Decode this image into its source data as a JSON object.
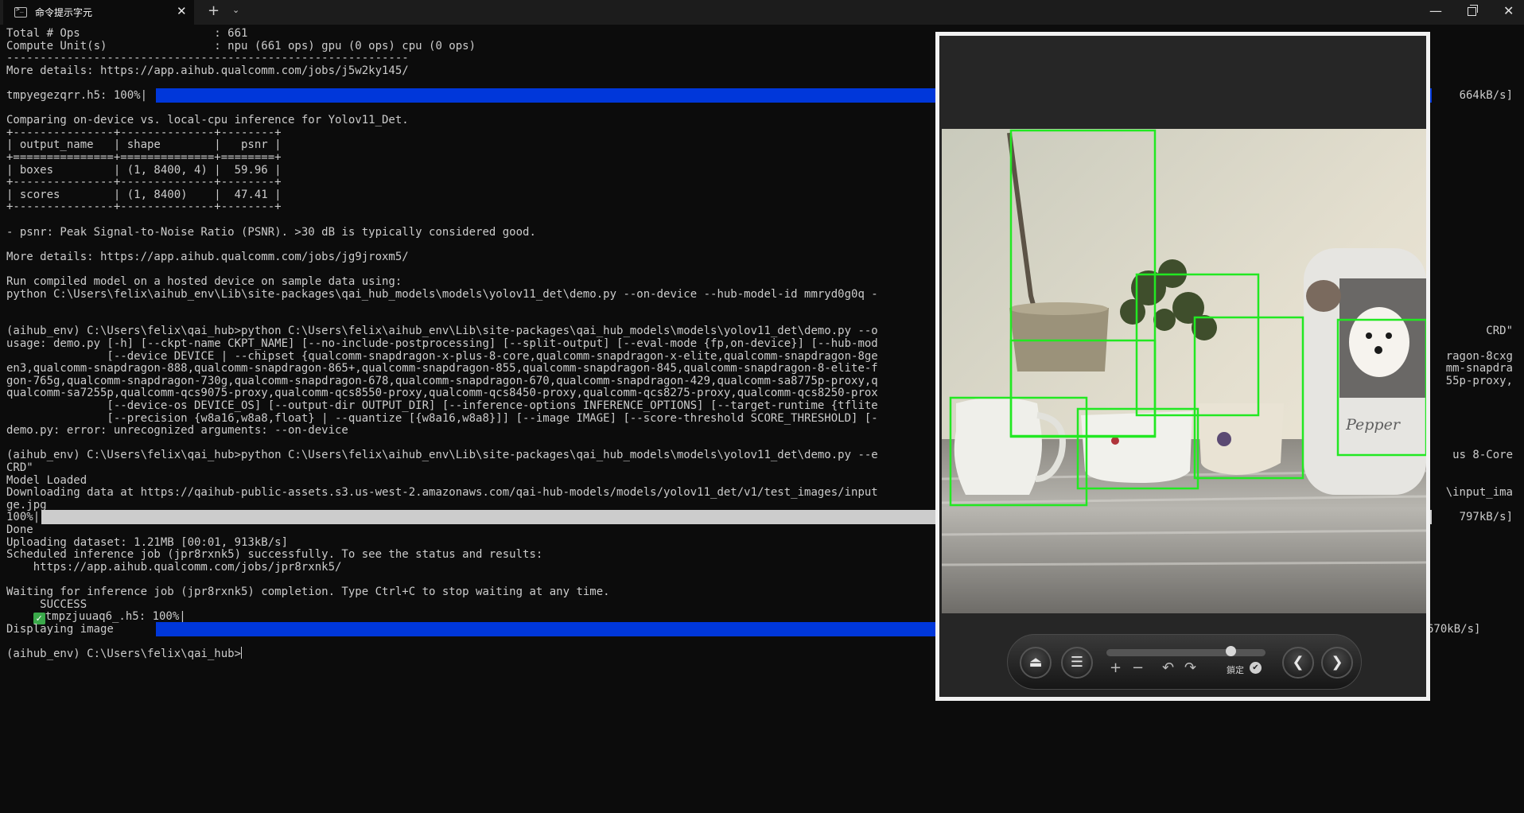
{
  "window": {
    "tab_title": "命令提示字元",
    "tab_close": "✕",
    "new_tab": "+",
    "tab_dropdown": "⌄",
    "minimize": "—",
    "close": "✕"
  },
  "terminal": {
    "lines": [
      "Total # Ops                    : 661",
      "Compute Unit(s)                : npu (661 ops) gpu (0 ops) cpu (0 ops)",
      "------------------------------------------------------------",
      "More details: https://app.aihub.qualcomm.com/jobs/j5w2ky145/",
      "",
      "tmpyegezqrr.h5: 100%|",
      "",
      "Comparing on-device vs. local-cpu inference for Yolov11_Det.",
      "+---------------+--------------+--------+",
      "| output_name   | shape        |   psnr |",
      "+===============+==============+========+",
      "| boxes         | (1, 8400, 4) |  59.96 |",
      "+---------------+--------------+--------+",
      "| scores        | (1, 8400)    |  47.41 |",
      "+---------------+--------------+--------+",
      "",
      "- psnr: Peak Signal-to-Noise Ratio (PSNR). >30 dB is typically considered good.",
      "",
      "More details: https://app.aihub.qualcomm.com/jobs/jg9jroxm5/",
      "",
      "Run compiled model on a hosted device on sample data using:",
      "python C:\\Users\\felix\\aihub_env\\Lib\\site-packages\\qai_hub_models\\models\\yolov11_det\\demo.py --on-device --hub-model-id mmryd0g0q -",
      "",
      "",
      "(aihub_env) C:\\Users\\felix\\qai_hub>python C:\\Users\\felix\\aihub_env\\Lib\\site-packages\\qai_hub_models\\models\\yolov11_det\\demo.py --o",
      "usage: demo.py [-h] [--ckpt-name CKPT_NAME] [--no-include-postprocessing] [--split-output] [--eval-mode {fp,on-device}] [--hub-mod",
      "               [--device DEVICE | --chipset {qualcomm-snapdragon-x-plus-8-core,qualcomm-snapdragon-x-elite,qualcomm-snapdragon-8ge",
      "en3,qualcomm-snapdragon-888,qualcomm-snapdragon-865+,qualcomm-snapdragon-855,qualcomm-snapdragon-845,qualcomm-snapdragon-8-elite-f",
      "gon-765g,qualcomm-snapdragon-730g,qualcomm-snapdragon-678,qualcomm-snapdragon-670,qualcomm-snapdragon-429,qualcomm-sa8775p-proxy,q",
      "qualcomm-sa7255p,qualcomm-qcs9075-proxy,qualcomm-qcs8550-proxy,qualcomm-qcs8450-proxy,qualcomm-qcs8275-proxy,qualcomm-qcs8250-prox",
      "               [--device-os DEVICE_OS] [--output-dir OUTPUT_DIR] [--inference-options INFERENCE_OPTIONS] [--target-runtime {tflite",
      "               [--precision {w8a16,w8a8,float} | --quantize [{w8a16,w8a8}]] [--image IMAGE] [--score-threshold SCORE_THRESHOLD] [-",
      "demo.py: error: unrecognized arguments: --on-device",
      "",
      "(aihub_env) C:\\Users\\felix\\qai_hub>python C:\\Users\\felix\\aihub_env\\Lib\\site-packages\\qai_hub_models\\models\\yolov11_det\\demo.py --e",
      "CRD\"",
      "Model Loaded",
      "Downloading data at https://qaihub-public-assets.s3.us-west-2.amazonaws.com/qai-hub-models/models/yolov11_det/v1/test_images/input",
      "ge.jpg",
      "100%|",
      "Done",
      "Uploading dataset: 1.21MB [00:01, 913kB/s]",
      "Scheduled inference job (jpr8rxnk5) successfully. To see the status and results:",
      "    https://app.aihub.qualcomm.com/jobs/jpr8rxnk5/",
      "",
      "Waiting for inference job (jpr8rxnk5) completion. Type Ctrl+C to stop waiting at any time.",
      "     SUCCESS",
      "tmpzjuuaq6_.h5: 100%|",
      "Displaying image",
      "",
      "(aihub_env) C:\\Users\\felix\\qai_hub>"
    ],
    "right_fragments": [
      {
        "row": 5,
        "text": "664kB/s]"
      },
      {
        "row": 24,
        "text": "CRD\""
      },
      {
        "row": 26,
        "text": "ragon-8cxg"
      },
      {
        "row": 27,
        "text": "mm-snapdra"
      },
      {
        "row": 28,
        "text": "55p-proxy,"
      },
      {
        "row": 34,
        "text": "us 8-Core"
      },
      {
        "row": 37,
        "text": "\\input_ima"
      },
      {
        "row": 39,
        "text": "797kB/s]"
      }
    ],
    "final_bar_suffix": "| 83.3k/83.3k [00:00<00:00, 670kB/s]",
    "progress_bars": [
      {
        "row": 5,
        "fraction": 1.0,
        "color": "#0037da"
      },
      {
        "row": 39,
        "fraction": 1.0,
        "color": "#cccccc"
      },
      {
        "row": 48,
        "fraction": 1.0,
        "color": "#0037da"
      }
    ],
    "success_icon": "check-icon"
  },
  "viewer": {
    "photo_caption": "Pepper",
    "toolbar": {
      "eject_icon": "⏏",
      "menu_icon": "☰",
      "zoom_in": "+",
      "zoom_out": "−",
      "rotate_left": "↶",
      "rotate_right": "↷",
      "lock_label": "鎖定",
      "lock_check": "✔",
      "prev": "❮",
      "next": "❯",
      "zoom_fraction": 0.78
    },
    "box_color": "#22e822"
  }
}
